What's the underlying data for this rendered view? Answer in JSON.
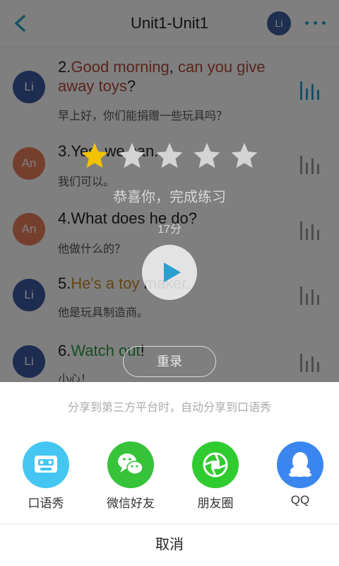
{
  "header": {
    "title": "Unit1-Unit1",
    "avatar": "Li"
  },
  "rows": [
    {
      "avatar": "Li",
      "num": "2.",
      "parts": [
        "Good morning",
        ", ",
        "can you give away toys",
        "?"
      ],
      "cn": "早上好，你们能捐赠一些玩具吗？"
    },
    {
      "avatar": "An",
      "num": "3.",
      "text": "Yes, we can.",
      "cn": "我们可以。"
    },
    {
      "avatar": "An",
      "num": "4.",
      "text": "What does he do?",
      "cn": "他做什么的？"
    },
    {
      "avatar": "Li",
      "num": "5.",
      "hl": "He's a toy",
      "rest": " maker.",
      "cn": "他是玩具制造商。"
    },
    {
      "avatar": "Li",
      "num": "6.",
      "hl": "Watch out",
      "rest": "!",
      "cn": "小心！"
    }
  ],
  "result": {
    "stars_filled": 1,
    "stars_total": 5,
    "congrats": "恭喜你，完成练习",
    "score": "17分",
    "rerecord_label": "重录"
  },
  "share": {
    "hint": "分享到第三方平台时，自动分享到口语秀",
    "options": [
      {
        "label": "口语秀",
        "icon": "cassette-icon",
        "color": "#45c6f2"
      },
      {
        "label": "微信好友",
        "icon": "wechat-icon",
        "color": "#36c33a"
      },
      {
        "label": "朋友圈",
        "icon": "moments-icon",
        "color": "#2fcb2f"
      },
      {
        "label": "QQ",
        "icon": "qq-icon",
        "color": "#3a86ee"
      }
    ],
    "cancel_label": "取消"
  },
  "colors": {
    "accent": "#2aa0cf",
    "star": "#f2c200",
    "avatar_li": "#3a5aa0",
    "avatar_an": "#e8805a"
  }
}
